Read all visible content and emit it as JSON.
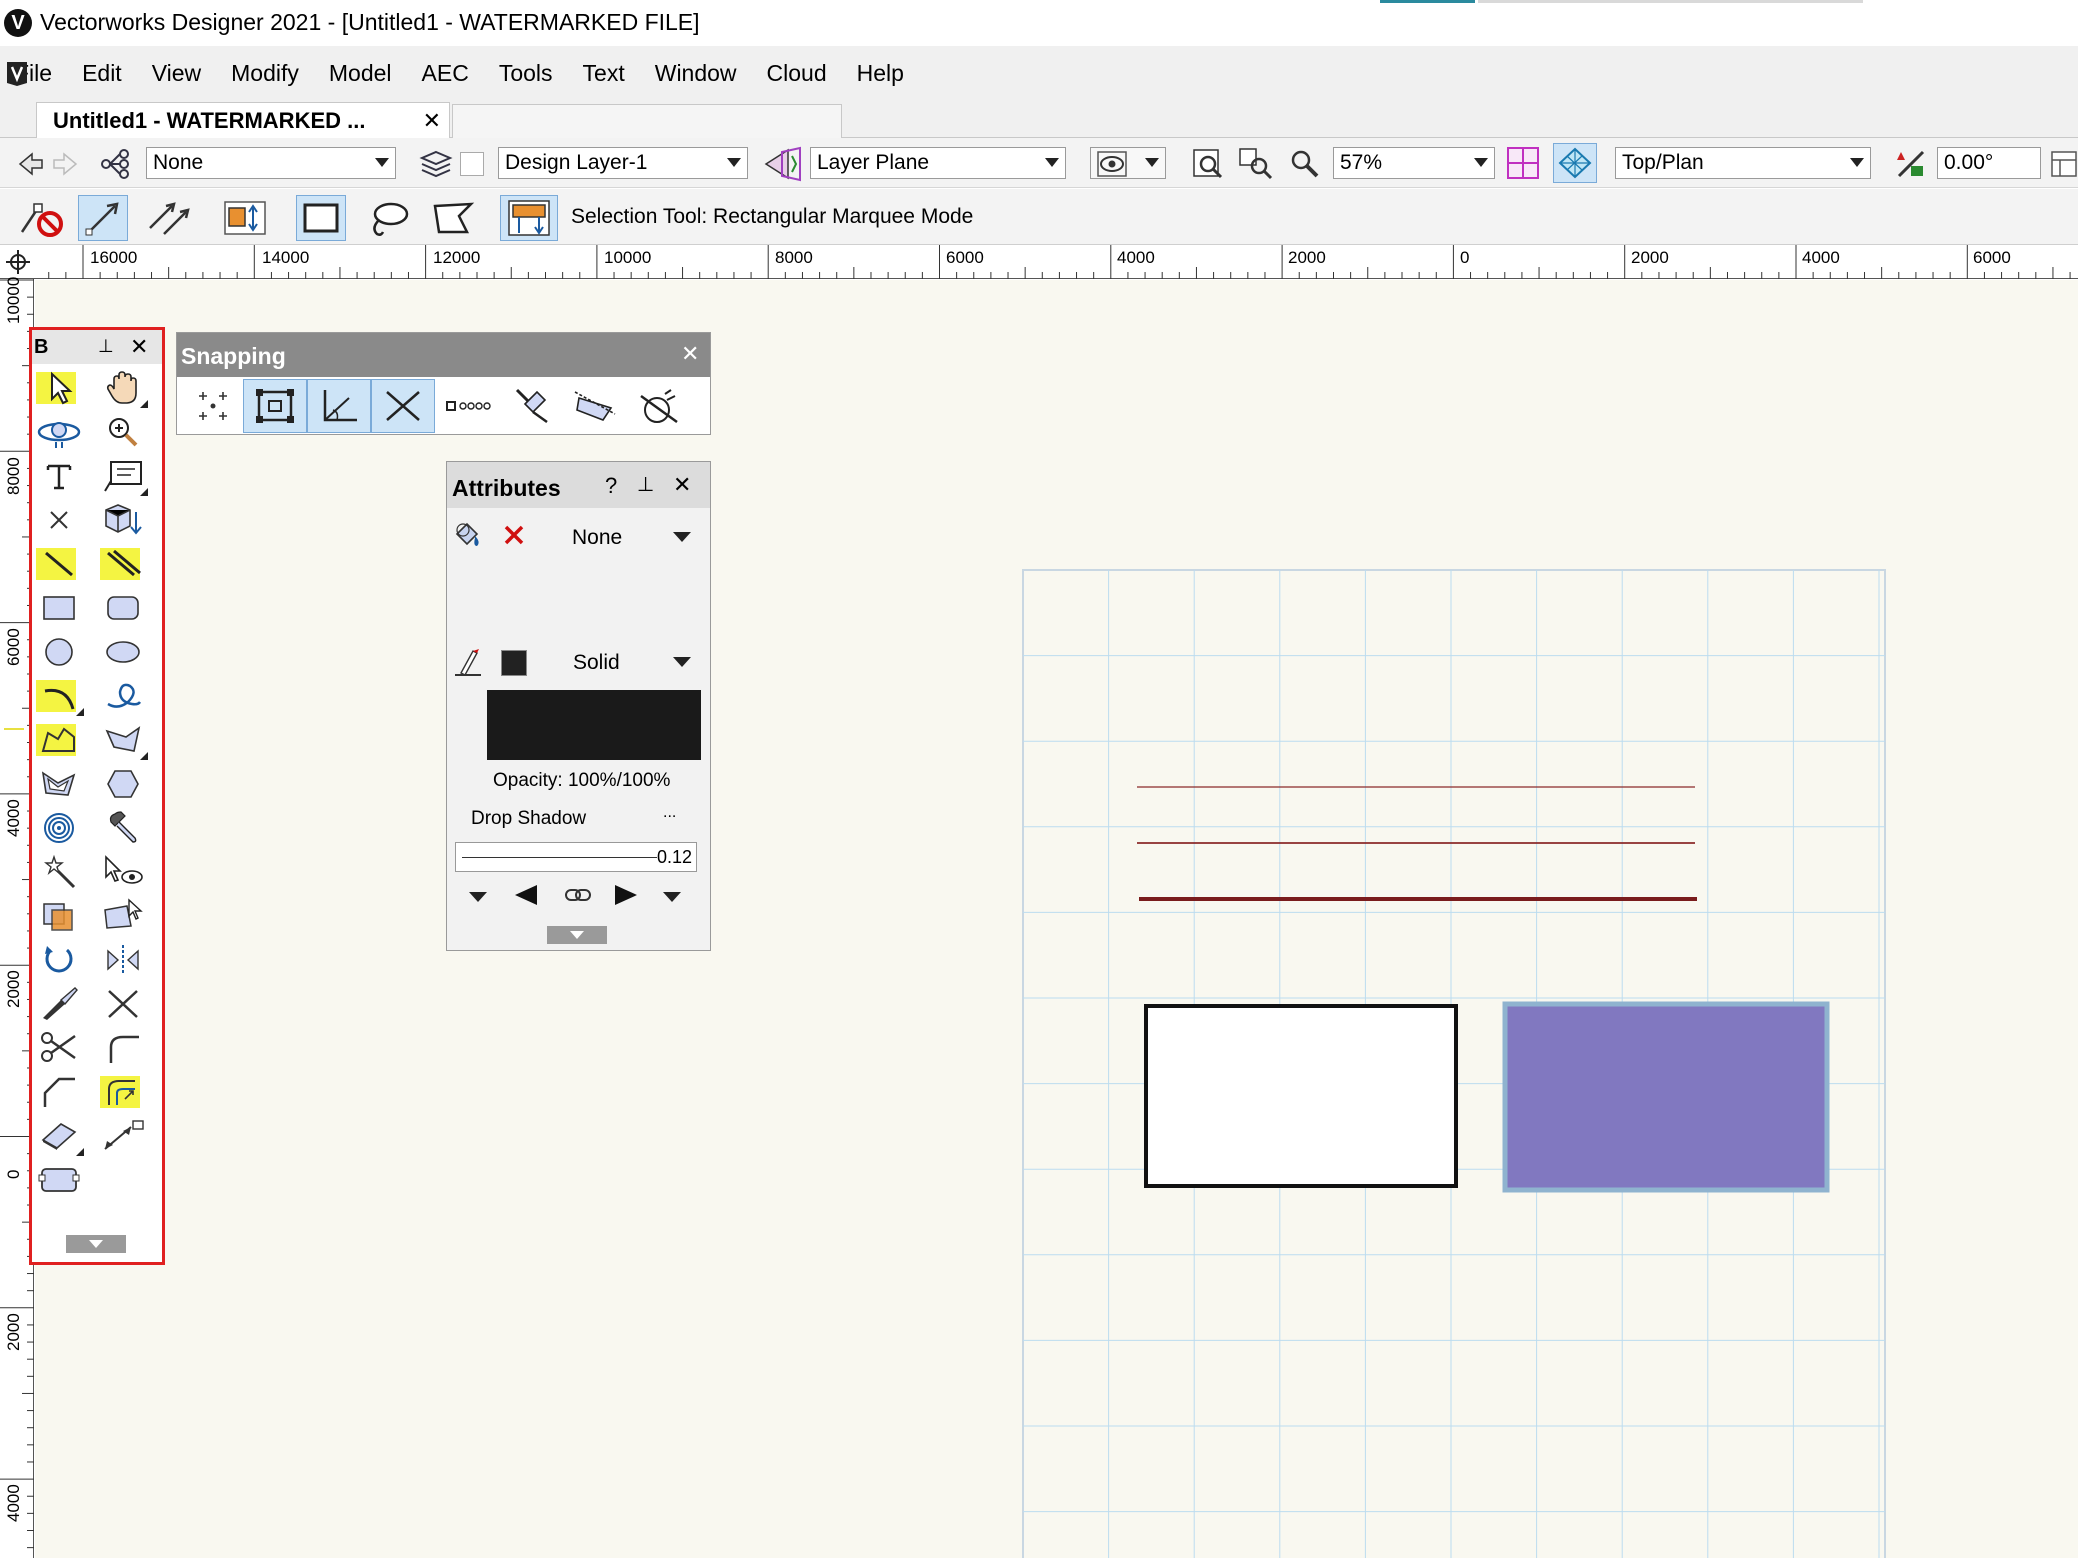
{
  "window": {
    "title": "Vectorworks Designer 2021 - [Untitled1 - WATERMARKED FILE]",
    "logo_letter": "V"
  },
  "menu": [
    "File",
    "Edit",
    "View",
    "Modify",
    "Model",
    "AEC",
    "Tools",
    "Text",
    "Window",
    "Cloud",
    "Help"
  ],
  "tab": {
    "label": "Untitled1 - WATERMARKED ...",
    "close": "✕"
  },
  "viewbar": {
    "class_value": "None",
    "layer_value": "Design Layer-1",
    "plane_value": "Layer Plane",
    "zoom_value": "57%",
    "view_value": "Top/Plan",
    "rotation_value": "0.00°"
  },
  "modebar": {
    "status": "Selection Tool: Rectangular Marquee Mode"
  },
  "rulers": {
    "horizontal": [
      "16000",
      "14000",
      "12000",
      "10000",
      "8000",
      "6000",
      "4000",
      "2000",
      "0",
      "2000",
      "4000",
      "6000"
    ],
    "vertical": [
      "10000",
      "8000",
      "6000",
      "4000",
      "2000",
      "0",
      "2000",
      "4000"
    ]
  },
  "basic_palette": {
    "title": "B",
    "pin": "⊥",
    "close": "✕"
  },
  "snapping": {
    "title": "Snapping",
    "close": "✕"
  },
  "attributes": {
    "title": "Attributes",
    "help": "?",
    "close": "✕",
    "fill_value": "None",
    "pen_value": "Solid",
    "opacity": "Opacity: 100%/100%",
    "drop_shadow": "Drop Shadow",
    "drop_shadow_more": "...",
    "line_weight": "0.12"
  },
  "colors": {
    "canvas": "#f9f8f0",
    "grid": "#bcdcef",
    "line": "#7a1c1c",
    "purple_fill": "#8178c0",
    "purple_border": "#8fb3cf",
    "palette_highlight": "#e02020",
    "tool_highlight": "#f4f442"
  }
}
